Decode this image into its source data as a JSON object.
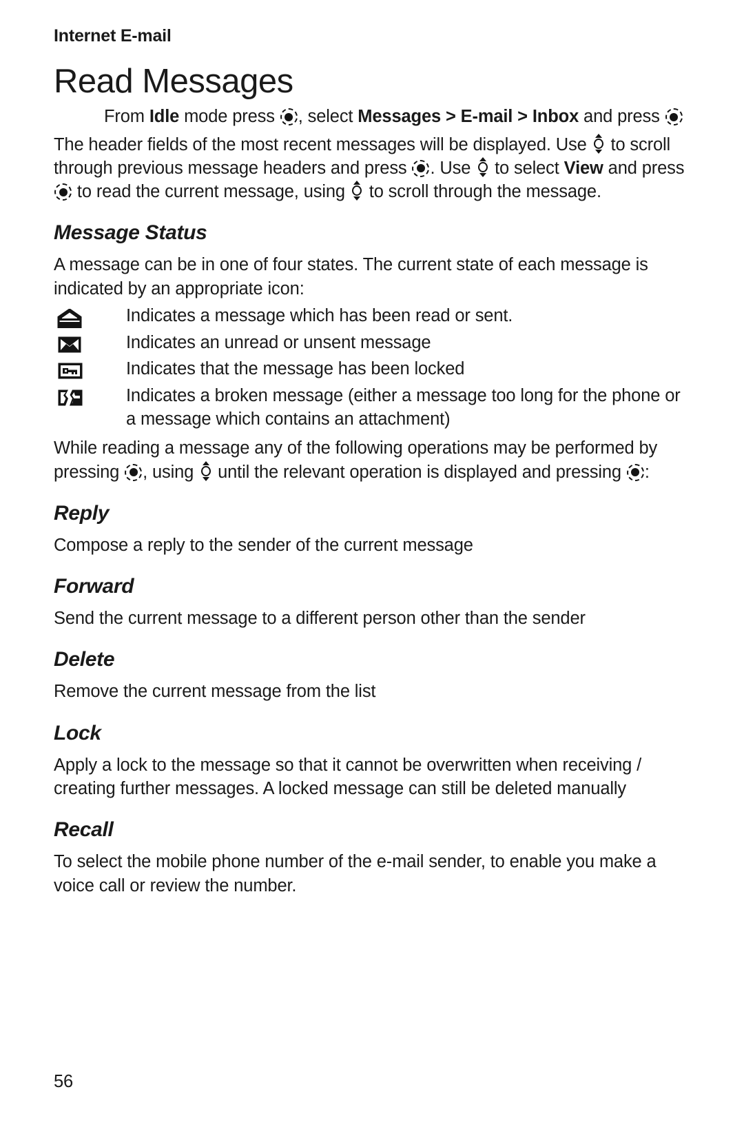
{
  "document": {
    "running_head": "Internet E-mail",
    "chapter_title": "Read Messages",
    "page_number": "56"
  },
  "intro": {
    "instruction_prefix": "From ",
    "instruction_idle": "Idle",
    "instruction_mid": " mode press ",
    "instruction_select": ", select ",
    "instruction_path": "Messages > E-mail > Inbox",
    "instruction_and_press": " and press ",
    "paragraph_line1": "The header fields of the most recent messages will be displayed.",
    "paragraph_use1": "Use ",
    "paragraph_scroll1": " to scroll through previous message headers and press ",
    "paragraph_period": ".",
    "paragraph_use2": "Use ",
    "paragraph_select_word": " to select ",
    "paragraph_view": "View",
    "paragraph_and_press2": " and press ",
    "paragraph_read": " to read the current message,",
    "paragraph_using": "using ",
    "paragraph_scroll_end": " to scroll through the message."
  },
  "message_status": {
    "heading": "Message Status",
    "intro": "A message can be in one of four states. The current state of each message is indicated by an appropriate icon:",
    "items": [
      {
        "icon": "opened-envelope-icon",
        "description": "Indicates a message which has been read or sent."
      },
      {
        "icon": "closed-envelope-icon",
        "description": "Indicates an unread or unsent message"
      },
      {
        "icon": "key-locked-envelope-icon",
        "description": "Indicates that the message has been locked"
      },
      {
        "icon": "broken-envelope-icon",
        "description": "Indicates a broken message (either a message too long for the phone or a message which contains an attachment)"
      }
    ],
    "operations_intro_1": "While reading a message any of the following operations may be performed by pressing ",
    "operations_intro_2": ", using ",
    "operations_intro_3": " until the relevant operation is displayed and pressing ",
    "operations_intro_4": ":"
  },
  "sections": [
    {
      "heading": "Reply",
      "body": "Compose a reply to the sender of the current message"
    },
    {
      "heading": "Forward",
      "body": "Send the current message to a different person other than the sender"
    },
    {
      "heading": "Delete",
      "body": "Remove the current message from the list"
    },
    {
      "heading": "Lock",
      "body": "Apply a lock to the message so that it cannot be overwritten when receiving / creating further messages. A locked message can still be deleted manually"
    },
    {
      "heading": "Recall",
      "body": "To select the mobile phone number of the e-mail sender, to enable you make a voice call or review the number."
    }
  ],
  "colors": {
    "text": "#1a1a1a",
    "background": "#ffffff"
  }
}
